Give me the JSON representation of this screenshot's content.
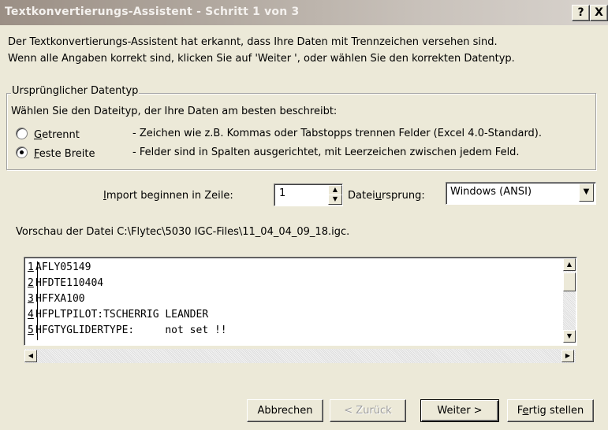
{
  "window": {
    "title": "Textkonvertierungs-Assistent - Schritt 1 von 3",
    "help_label": "?",
    "close_label": "X"
  },
  "intro": {
    "line1": "Der Textkonvertierungs-Assistent hat erkannt, dass Ihre Daten mit Trennzeichen versehen sind.",
    "line2": "Wenn alle Angaben korrekt sind, klicken Sie auf 'Weiter ', oder wählen Sie den korrekten Datentyp."
  },
  "datatype_group": {
    "legend": "Ursprünglicher Datentyp",
    "instruction": "Wählen Sie den Dateityp, der Ihre Daten am besten beschreibt:",
    "options": [
      {
        "accel": "G",
        "rest": "etrennt",
        "selected": false,
        "description": "- Zeichen wie z.B. Kommas oder Tabstopps trennen Felder (Excel 4.0-Standard)."
      },
      {
        "accel": "F",
        "rest": "este Breite",
        "selected": true,
        "description": "- Felder sind in Spalten ausgerichtet, mit Leerzeichen zwischen jedem Feld."
      }
    ]
  },
  "import_row": {
    "label_accel": "I",
    "label_rest": "mport beginnen in Zeile:",
    "value": "1",
    "origin_label_pre": "Datei",
    "origin_label_accel": "u",
    "origin_label_post": "rsprung:",
    "origin_value": "Windows (ANSI)"
  },
  "preview": {
    "label": "Vorschau der Datei C:\\Flytec\\5030 IGC-Files\\11_04_04_09_18.igc.",
    "lines": [
      {
        "num": "1",
        "text": "AFLY05149"
      },
      {
        "num": "2",
        "text": "HFDTE110404"
      },
      {
        "num": "3",
        "text": "HFFXA100"
      },
      {
        "num": "4",
        "text": "HFPLTPILOT:TSCHERRIG LEANDER"
      },
      {
        "num": "5",
        "text": "HFGTYGLIDERTYPE:     not set !!"
      }
    ]
  },
  "buttons": {
    "cancel": "Abbrechen",
    "back": "< Zurück",
    "next": "Weiter >",
    "finish_pre": "F",
    "finish_accel": "e",
    "finish_post": "rtig stellen"
  },
  "icons": {
    "spin_up": "▲",
    "spin_down": "▼",
    "dropdown": "▼",
    "scroll_up": "▲",
    "scroll_down": "▼",
    "scroll_left": "◀",
    "scroll_right": "▶"
  }
}
